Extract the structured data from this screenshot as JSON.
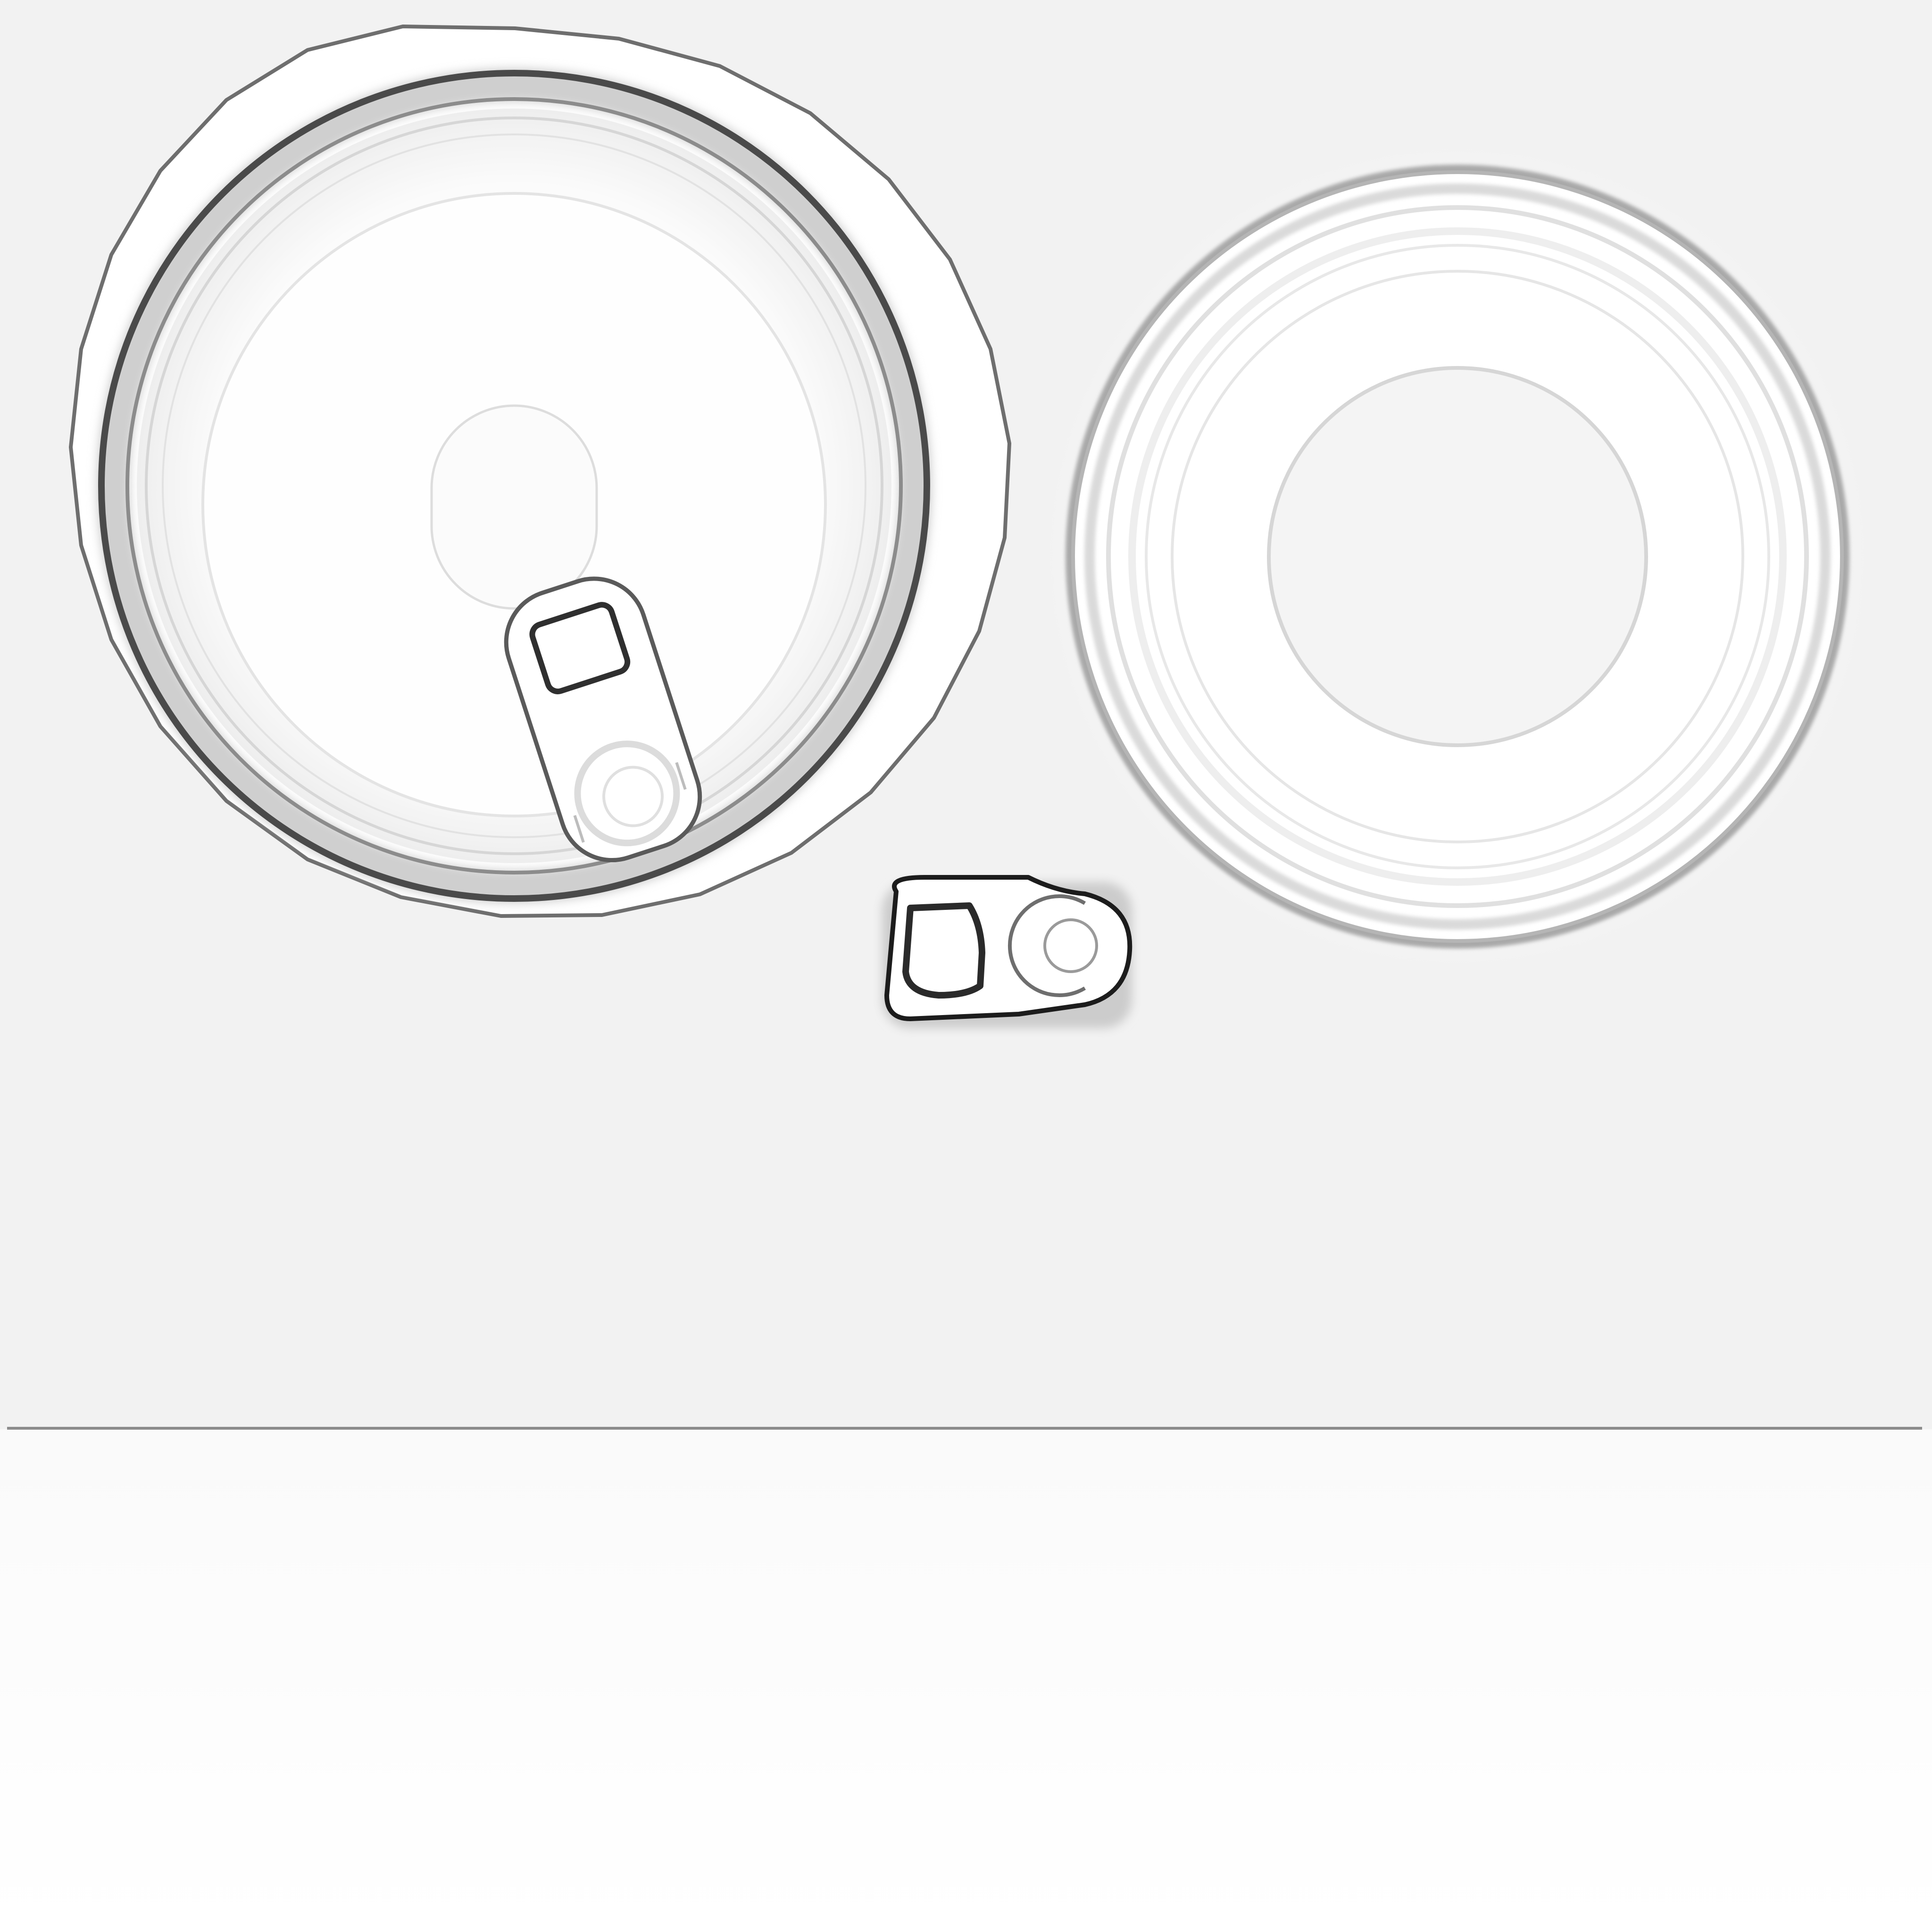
{
  "texture": {
    "kind": "ambient-occlusion bake of a beverage can (top lid, bottom, pull tab, body strip)",
    "colors": {
      "background": "#f2f2f2",
      "highlight": "#ffffff",
      "midtone": "#d9d9d9",
      "shadow": "#8c8c8c",
      "deep_shadow": "#3a3a3a"
    }
  }
}
